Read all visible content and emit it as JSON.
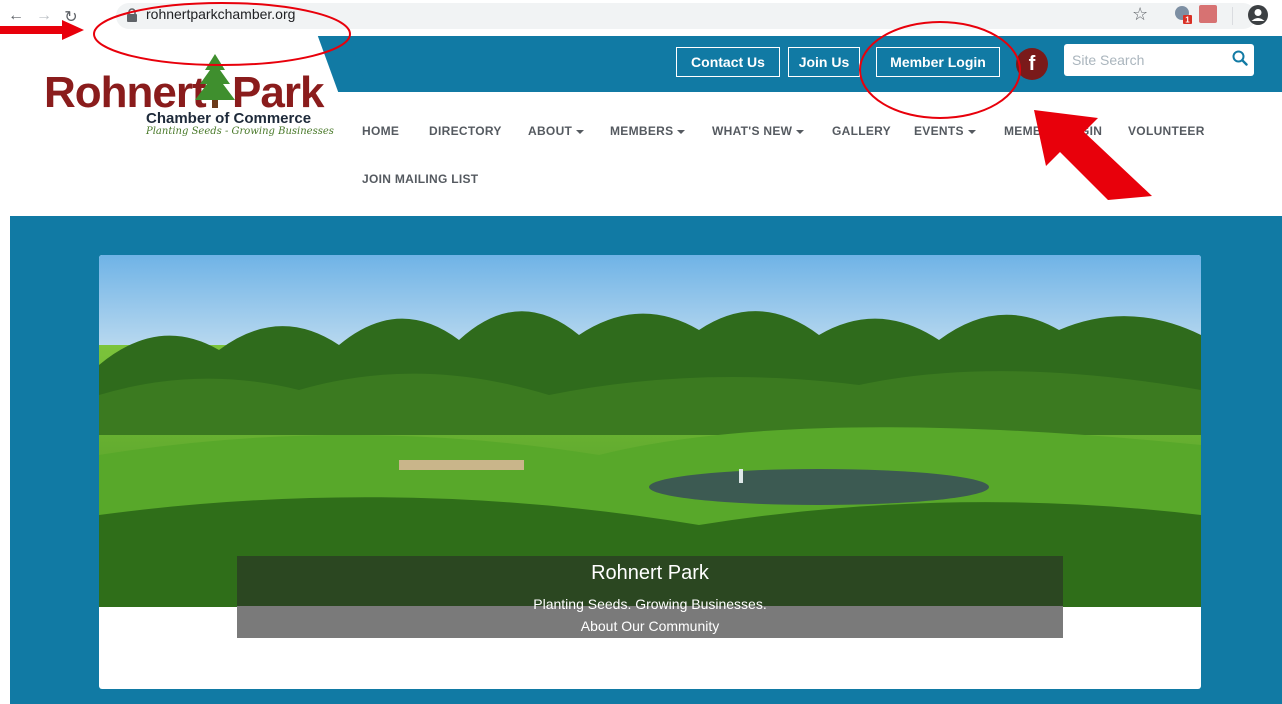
{
  "browser": {
    "url": "rohnertparkchamber.org",
    "ext_badge": "1"
  },
  "header": {
    "buttons": {
      "contact": "Contact Us",
      "join": "Join Us",
      "login": "Member Login"
    },
    "facebook_glyph": "f",
    "search": {
      "placeholder": "Site Search"
    }
  },
  "logo": {
    "word1": "Rohnert",
    "word2": "Park",
    "subtitle": "Chamber of Commerce",
    "tagline": "Planting Seeds - Growing Businesses"
  },
  "nav": {
    "home": "HOME",
    "directory": "DIRECTORY",
    "about": "ABOUT",
    "members": "MEMBERS",
    "whats_new": "WHAT'S NEW",
    "gallery": "GALLERY",
    "events": "EVENTS",
    "member_login": "MEMBER LOGIN",
    "volunteer": "VOLUNTEER",
    "join_mailing_list": "JOIN MAILING LIST"
  },
  "hero": {
    "title": "Rohnert Park",
    "subtitle": "Planting Seeds. Growing Businesses.",
    "link": "About Our Community"
  },
  "colors": {
    "brand_blue": "#117aa4",
    "logo_red": "#8a1c1c",
    "annotation_red": "#e8000b"
  },
  "icons": [
    "back-icon",
    "forward-icon",
    "reload-icon",
    "lock-icon",
    "star-icon",
    "extension-icon",
    "pdf-icon",
    "profile-icon",
    "facebook-icon",
    "search-icon"
  ]
}
